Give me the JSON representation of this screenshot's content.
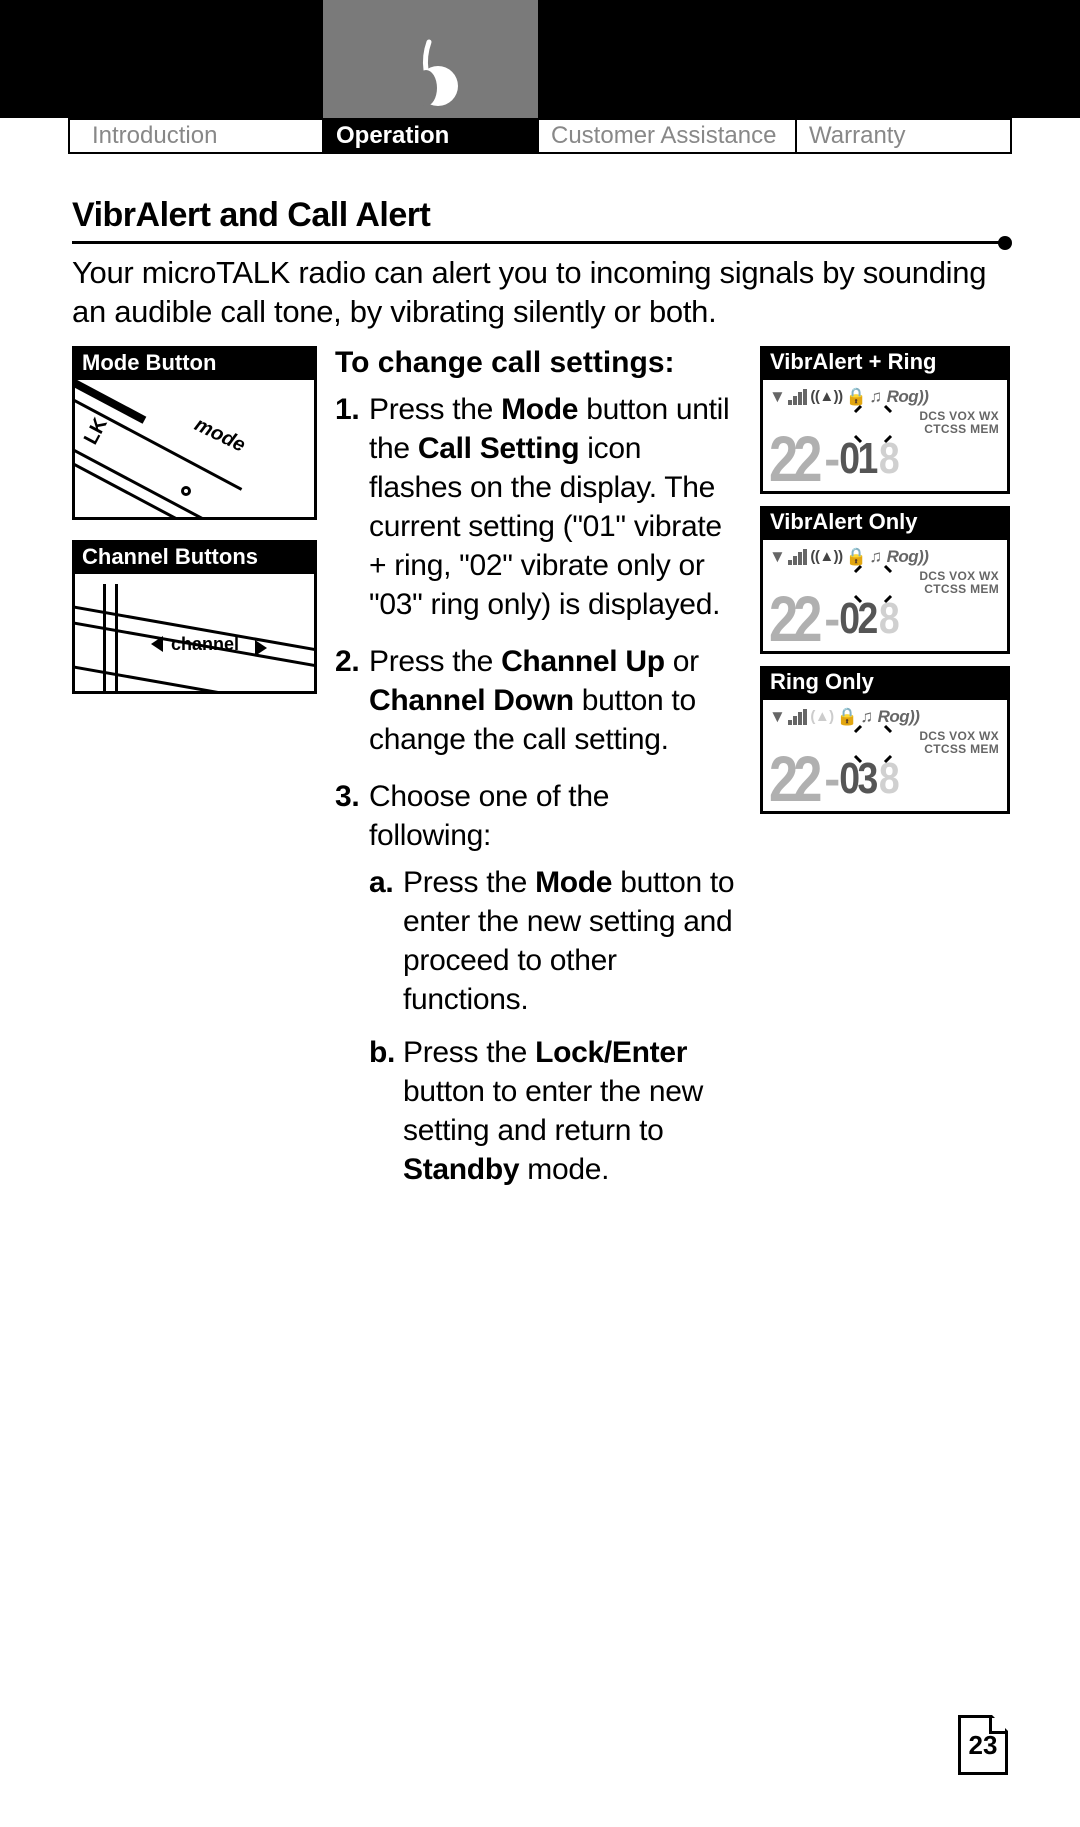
{
  "tabs": {
    "introduction": "Introduction",
    "operation": "Operation",
    "customer": "Customer Assistance",
    "warranty": "Warranty"
  },
  "heading": "VibrAlert and Call Alert",
  "intro": "Your microTALK radio can alert you to incoming signals by sounding an audible call tone, by vibrating silently or both.",
  "left": {
    "mode_label": "Mode Button",
    "mode_word": "mode",
    "lk_word": "LK",
    "channel_label": "Channel Buttons",
    "channel_word": "channel"
  },
  "mid": {
    "subhead": "To change call settings:",
    "step1_pre": "Press the ",
    "step1_b1": "Mode",
    "step1_mid1": " button until the ",
    "step1_b2": "Call Setting",
    "step1_post": " icon flashes on the display. The current setting (\"01\" vibrate + ring, \"02\" vibrate only or \"03\" ring only) is displayed.",
    "step2_pre": "Press the ",
    "step2_b1": "Channel Up",
    "step2_mid": " or ",
    "step2_b2": "Channel Down",
    "step2_post": " button to change the call setting.",
    "step3": "Choose one of the following:",
    "step3a_pre": "Press the ",
    "step3a_b1": "Mode",
    "step3a_post": " button to enter the new setting and proceed to other functions.",
    "step3b_pre": "Press the ",
    "step3b_b1": "Lock/Enter",
    "step3b_mid": " button to enter the new setting and return to ",
    "step3b_b2": "Standby",
    "step3b_post": " mode."
  },
  "right": {
    "lcd1_label": "VibrAlert + Ring",
    "lcd2_label": "VibrAlert Only",
    "lcd3_label": "Ring Only",
    "rog": "Rog",
    "sub1": "DCS VOX WX",
    "sub2": "CTCSS  MEM",
    "big": "22",
    "val1": "01",
    "val2": "02",
    "val3": "03",
    "ghost": "8"
  },
  "page": "23"
}
